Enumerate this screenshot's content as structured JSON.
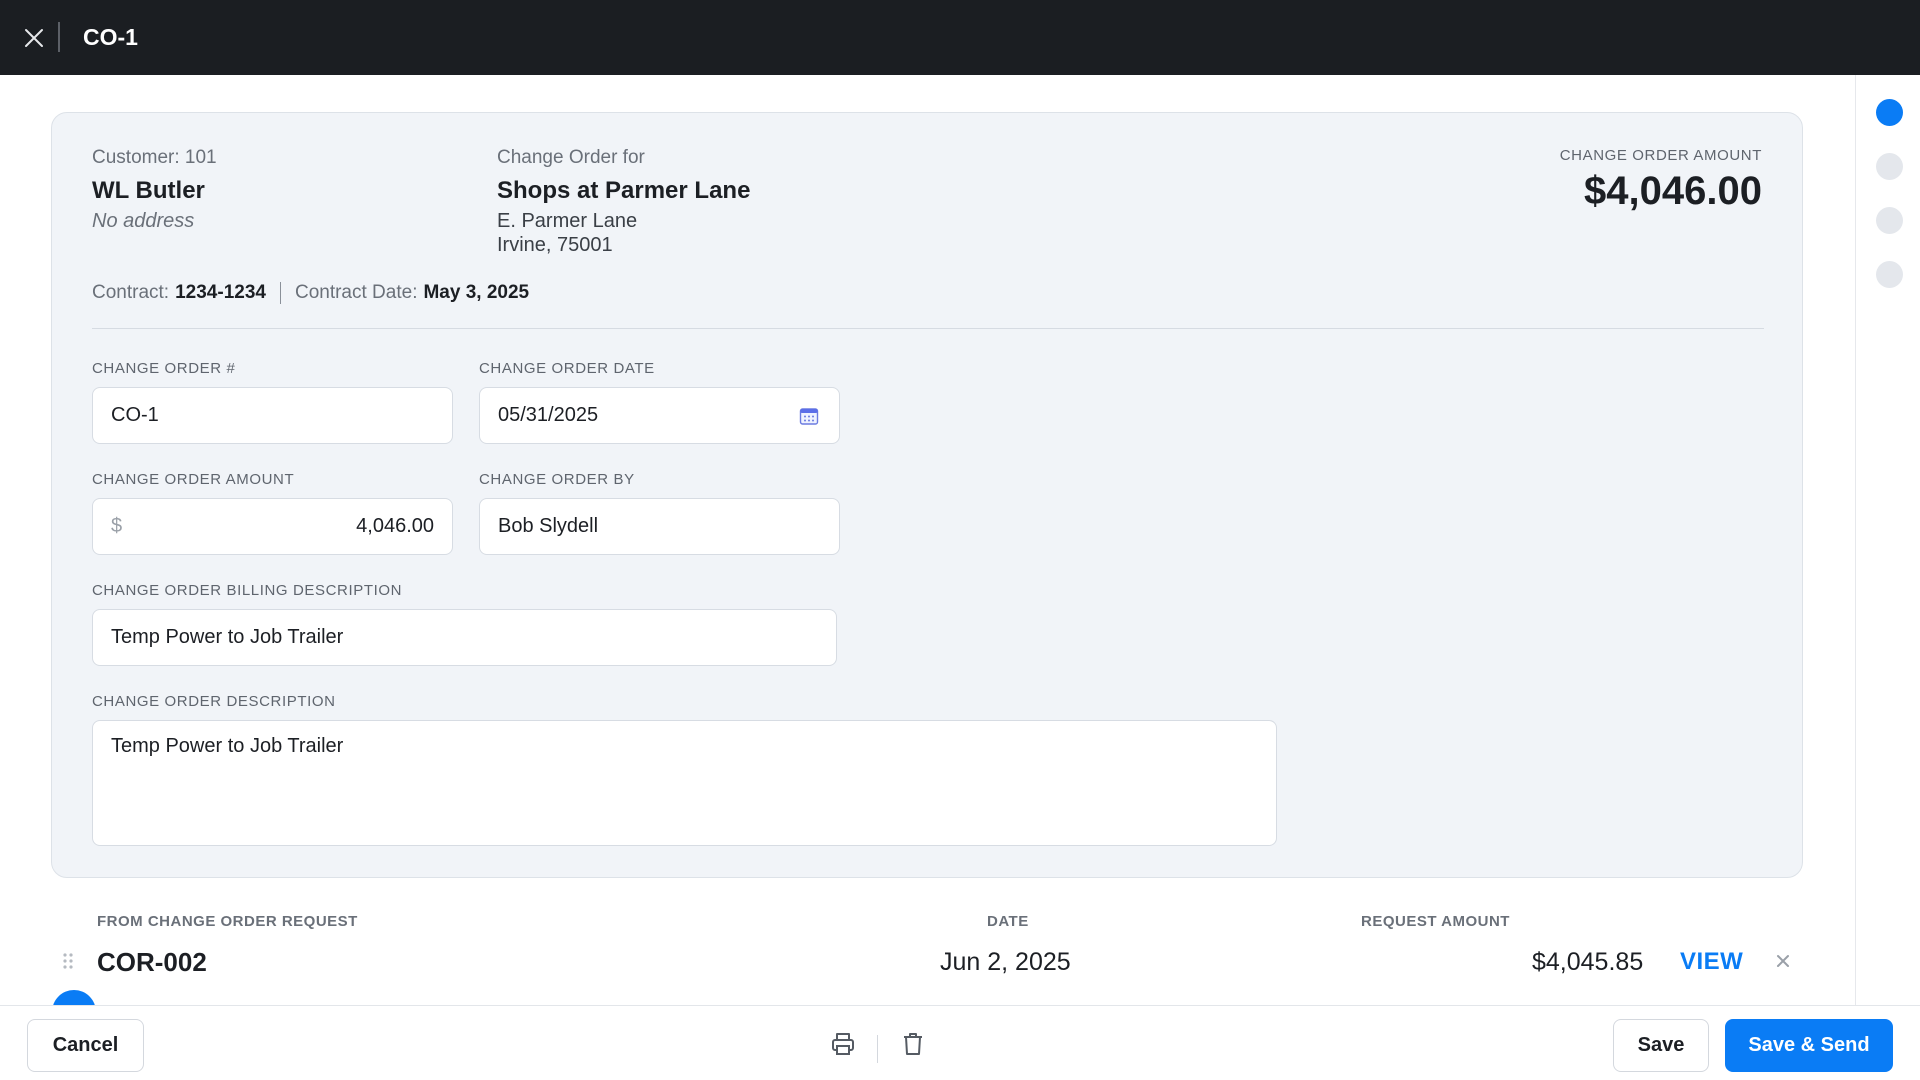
{
  "header": {
    "title": "CO-1"
  },
  "summary": {
    "customer_label": "Customer: 101",
    "customer_name": "WL Butler",
    "customer_address": "No address",
    "change_order_for_label": "Change Order for",
    "project_name": "Shops at Parmer Lane",
    "project_address_line1": "E. Parmer Lane",
    "project_address_line2": "Irvine, 75001",
    "amount_label": "CHANGE ORDER AMOUNT",
    "amount_value": "$4,046.00",
    "contract_label": "Contract:",
    "contract_value": "1234-1234",
    "contract_date_label": "Contract Date:",
    "contract_date_value": "May 3, 2025"
  },
  "form": {
    "co_number_label": "CHANGE ORDER #",
    "co_number_value": "CO-1",
    "co_date_label": "CHANGE ORDER DATE",
    "co_date_value": "05/31/2025",
    "co_amount_label": "CHANGE ORDER AMOUNT",
    "co_amount_currency": "$",
    "co_amount_value": "4,046.00",
    "co_by_label": "CHANGE ORDER BY",
    "co_by_value": "Bob Slydell",
    "billing_desc_label": "CHANGE ORDER BILLING DESCRIPTION",
    "billing_desc_value": "Temp Power to Job Trailer",
    "desc_label": "CHANGE ORDER DESCRIPTION",
    "desc_value": "Temp Power to Job Trailer"
  },
  "requests": {
    "columns": {
      "from": "FROM CHANGE ORDER REQUEST",
      "date": "DATE",
      "amount": "REQUEST AMOUNT"
    },
    "rows": [
      {
        "id": "COR-002",
        "date": "Jun 2, 2025",
        "amount": "$4,045.85",
        "action": "VIEW"
      }
    ]
  },
  "footer": {
    "cancel_label": "Cancel",
    "save_label": "Save",
    "save_send_label": "Save & Send"
  },
  "colors": {
    "accent": "#0a7cf5",
    "topbar": "#1b1e22",
    "card_bg": "#f1f4f8"
  }
}
